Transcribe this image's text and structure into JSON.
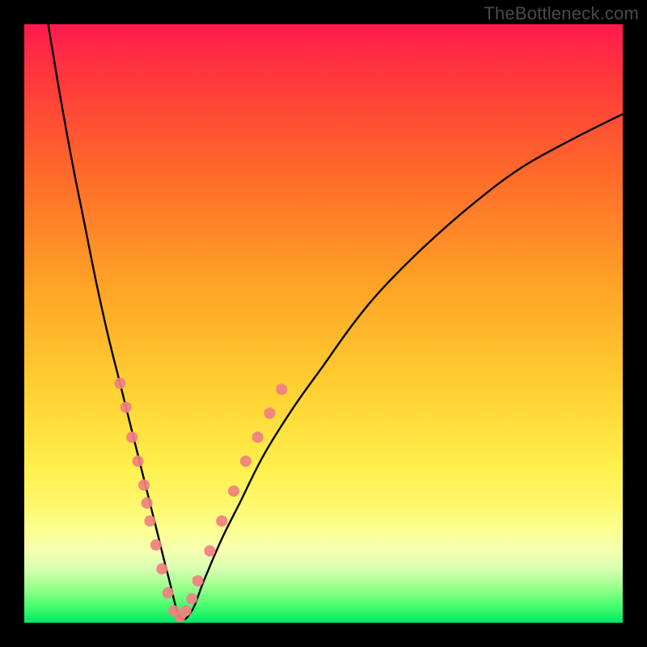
{
  "attribution": "TheBottleneck.com",
  "chart_data": {
    "type": "line",
    "title": "",
    "xlabel": "",
    "ylabel": "",
    "xlim": [
      0,
      100
    ],
    "ylim": [
      0,
      100
    ],
    "background_gradient": {
      "top_color": "#ff1a4d",
      "bottom_color": "#00e865",
      "meaning": "red = high bottleneck, green = low bottleneck"
    },
    "series": [
      {
        "name": "bottleneck-curve",
        "description": "V-shaped bottleneck percentage curve; minimum near x≈25",
        "x": [
          4,
          6,
          8,
          10,
          12,
          14,
          16,
          18,
          20,
          22,
          24,
          26,
          28,
          30,
          33,
          36,
          40,
          45,
          50,
          55,
          60,
          67,
          75,
          83,
          92,
          100
        ],
        "y": [
          100,
          88,
          77,
          67,
          57,
          48,
          40,
          32,
          24,
          16,
          8,
          1,
          2,
          7,
          14,
          20,
          28,
          36,
          43,
          50,
          56,
          63,
          70,
          76,
          81,
          85
        ]
      }
    ],
    "highlighted_points": {
      "description": "Salmon-colored marker clusters along both arms of the V near the trough",
      "color": "#f08080",
      "points": [
        {
          "x": 16,
          "y": 40
        },
        {
          "x": 17,
          "y": 36
        },
        {
          "x": 18,
          "y": 31
        },
        {
          "x": 19,
          "y": 27
        },
        {
          "x": 20,
          "y": 23
        },
        {
          "x": 20.5,
          "y": 20
        },
        {
          "x": 21,
          "y": 17
        },
        {
          "x": 22,
          "y": 13
        },
        {
          "x": 23,
          "y": 9
        },
        {
          "x": 24,
          "y": 5
        },
        {
          "x": 25,
          "y": 2
        },
        {
          "x": 26,
          "y": 1
        },
        {
          "x": 27,
          "y": 2
        },
        {
          "x": 28,
          "y": 4
        },
        {
          "x": 29,
          "y": 7
        },
        {
          "x": 31,
          "y": 12
        },
        {
          "x": 33,
          "y": 17
        },
        {
          "x": 35,
          "y": 22
        },
        {
          "x": 37,
          "y": 27
        },
        {
          "x": 39,
          "y": 31
        },
        {
          "x": 41,
          "y": 35
        },
        {
          "x": 43,
          "y": 39
        }
      ]
    }
  }
}
